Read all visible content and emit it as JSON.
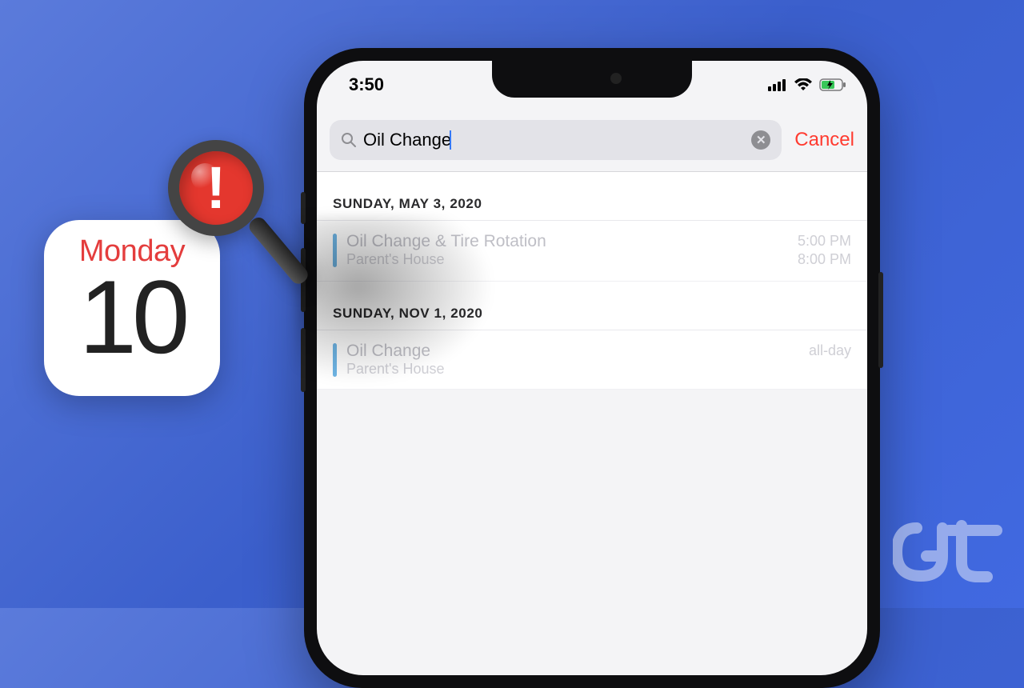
{
  "calendar_widget": {
    "day_name": "Monday",
    "day_number": "10"
  },
  "phone": {
    "status": {
      "time": "3:50"
    },
    "search": {
      "query": "Oil Change",
      "cancel_label": "Cancel"
    },
    "sections": [
      {
        "header": "SUNDAY, MAY 3, 2020",
        "events": [
          {
            "title": "Oil Change & Tire Rotation",
            "location": "Parent's House",
            "time_start": "5:00 PM",
            "time_end": "8:00 PM"
          }
        ]
      },
      {
        "header": "SUNDAY, NOV 1, 2020",
        "events": [
          {
            "title": "Oil Change",
            "location": "Parent's House",
            "time_label": "all-day"
          }
        ]
      }
    ]
  }
}
